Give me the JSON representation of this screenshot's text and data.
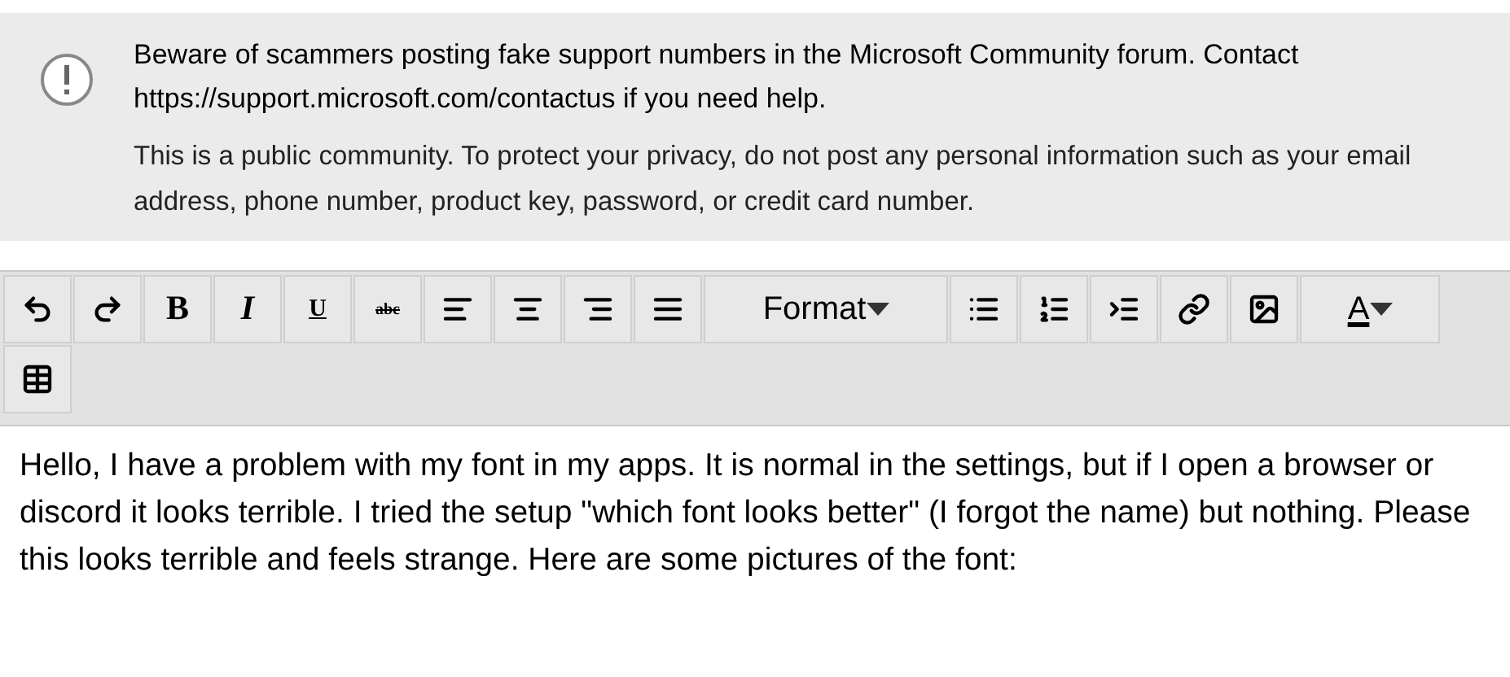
{
  "notice": {
    "warning": "Beware of scammers posting fake support numbers in the Microsoft Community forum. Contact https://support.microsoft.com/contactus if you need help.",
    "privacy": "This is a public community. To protect your privacy, do not post any personal information such as your email address, phone number, product key, password, or credit card number."
  },
  "toolbar": [
    {
      "kind": "undo"
    },
    {
      "kind": "redo"
    },
    {
      "kind": "bold",
      "label": "B"
    },
    {
      "kind": "italic",
      "label": "I"
    },
    {
      "kind": "underline",
      "label": "U"
    },
    {
      "kind": "strike",
      "label": "abc"
    },
    {
      "kind": "align-left"
    },
    {
      "kind": "align-center"
    },
    {
      "kind": "align-right"
    },
    {
      "kind": "align-justify"
    },
    {
      "kind": "dropdown",
      "label": "Format"
    },
    {
      "kind": "bullet-list"
    },
    {
      "kind": "numbered-list"
    },
    {
      "kind": "indent"
    },
    {
      "kind": "link"
    },
    {
      "kind": "image"
    },
    {
      "kind": "color",
      "label": "A"
    },
    {
      "kind": "table"
    }
  ],
  "body": "Hello, I have a problem with my font in my apps. It is normal in the settings, but if I open a browser or discord it looks terrible. I tried the setup \"which font looks better\" (I forgot the name) but nothing. Please this looks terrible and feels strange. Here are some pictures of the font:"
}
